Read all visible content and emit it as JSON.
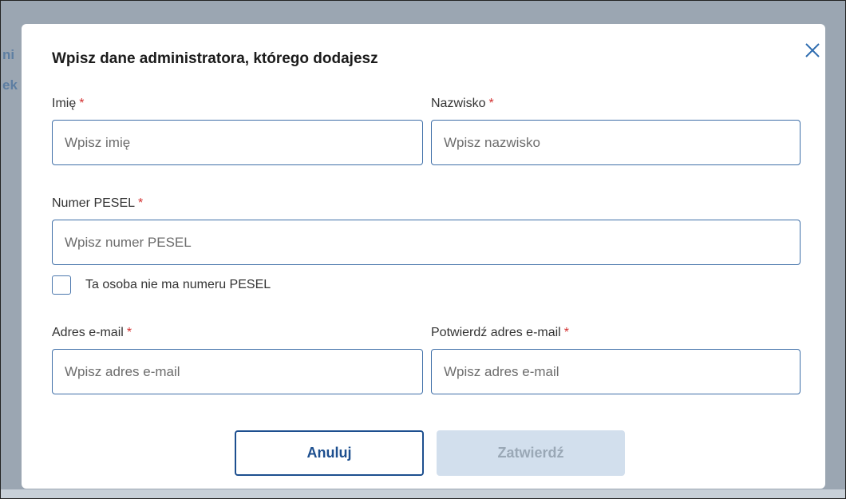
{
  "dialog": {
    "title": "Wpisz dane administratora, którego dodajesz",
    "close_icon": "close-icon"
  },
  "fields": {
    "first_name": {
      "label": "Imię",
      "required_mark": "*",
      "placeholder": "Wpisz imię",
      "value": ""
    },
    "last_name": {
      "label": "Nazwisko",
      "required_mark": "*",
      "placeholder": "Wpisz nazwisko",
      "value": ""
    },
    "pesel": {
      "label": "Numer PESEL",
      "required_mark": "*",
      "placeholder": "Wpisz numer PESEL",
      "value": ""
    },
    "no_pesel_checkbox": {
      "label": "Ta osoba nie ma numeru PESEL",
      "checked": false
    },
    "email": {
      "label": "Adres e-mail",
      "required_mark": "*",
      "placeholder": "Wpisz adres e-mail",
      "value": ""
    },
    "email_confirm": {
      "label": "Potwierdź adres e-mail",
      "required_mark": "*",
      "placeholder": "Wpisz adres e-mail",
      "value": ""
    }
  },
  "buttons": {
    "cancel": "Anuluj",
    "submit": "Zatwierdź"
  },
  "colors": {
    "accent": "#1d4f8f",
    "required": "#d32f2f",
    "disabled_button_bg": "#d2dfed"
  }
}
